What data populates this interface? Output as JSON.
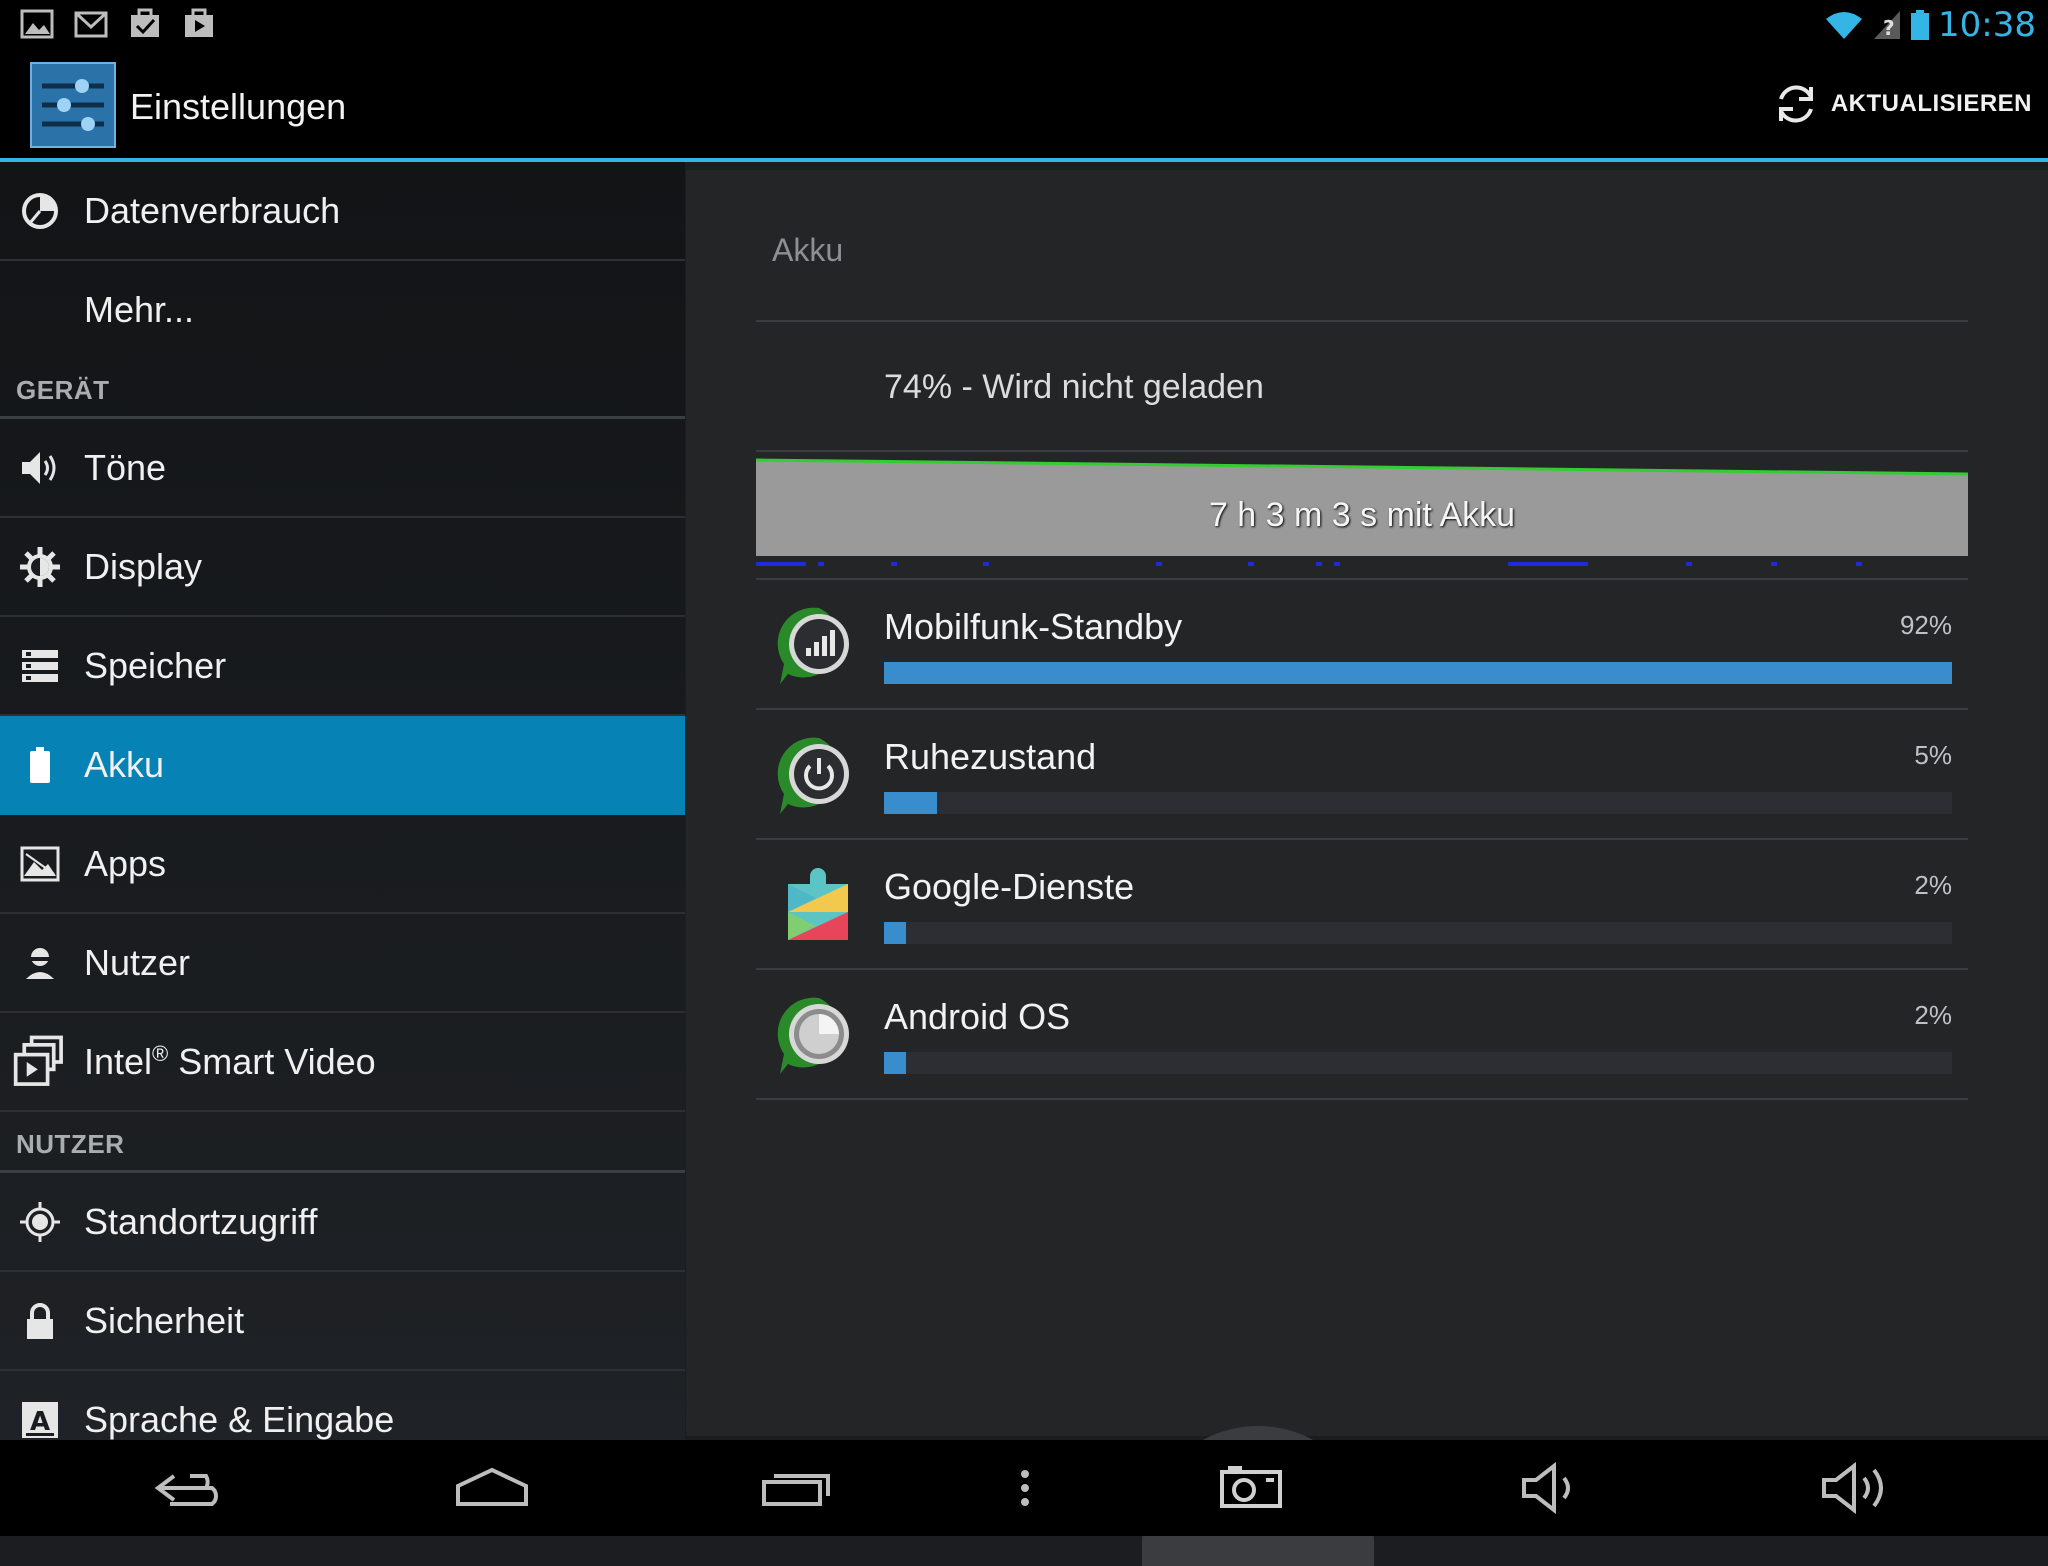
{
  "status_bar": {
    "time": "10:38",
    "icons_left": [
      "gallery-icon",
      "gmail-icon",
      "task-icon",
      "play-store-icon"
    ],
    "icons_right": [
      "wifi-icon",
      "no-signal-icon",
      "battery-icon"
    ]
  },
  "action_bar": {
    "title": "Einstellungen",
    "refresh_label": "AKTUALISIEREN"
  },
  "sidebar": {
    "items_top": [
      {
        "label": "Datenverbrauch",
        "icon": "data-usage-icon"
      },
      {
        "label": "Mehr...",
        "icon": ""
      }
    ],
    "section_device": "GERÄT",
    "device_items": [
      {
        "label": "Töne",
        "icon": "sound-icon"
      },
      {
        "label": "Display",
        "icon": "display-icon"
      },
      {
        "label": "Speicher",
        "icon": "storage-icon"
      },
      {
        "label": "Akku",
        "icon": "battery-icon",
        "selected": true
      },
      {
        "label": "Apps",
        "icon": "apps-icon"
      },
      {
        "label": "Nutzer",
        "icon": "user-icon"
      },
      {
        "label": "Intel",
        "label_sup": "®",
        "label_rest": " Smart Video",
        "icon": "smart-video-icon"
      }
    ],
    "section_user": "NUTZER",
    "user_items": [
      {
        "label": "Standortzugriff",
        "icon": "location-icon"
      },
      {
        "label": "Sicherheit",
        "icon": "lock-icon"
      },
      {
        "label": "Sprache & Eingabe",
        "icon": "language-icon"
      }
    ]
  },
  "detail": {
    "title": "Akku",
    "status": "74% - Wird nicht geladen",
    "graph_label": "7 h 3 m 3 s mit Akku",
    "battery_start_level": 0.96,
    "battery_end_level": 0.82,
    "usage": [
      {
        "name": "Mobilfunk-Standby",
        "percent_label": "92%",
        "percent": 100,
        "icon": "cell-standby-icon"
      },
      {
        "name": "Ruhezustand",
        "percent_label": "5%",
        "percent": 5,
        "icon": "idle-power-icon"
      },
      {
        "name": "Google-Dienste",
        "percent_label": "2%",
        "percent": 2,
        "icon": "google-services-icon"
      },
      {
        "name": "Android OS",
        "percent_label": "2%",
        "percent": 2,
        "icon": "android-os-icon"
      }
    ]
  },
  "nav_bar": {
    "buttons": [
      "back-icon",
      "home-icon",
      "recent-apps-icon",
      "menu-icon",
      "screenshot-icon",
      "volume-down-icon",
      "volume-up-icon"
    ]
  },
  "colors": {
    "accent": "#33b5e5",
    "selected_bg": "#0683b4",
    "bar_fill": "#3a8dcc",
    "graph_line": "#33cc33"
  }
}
